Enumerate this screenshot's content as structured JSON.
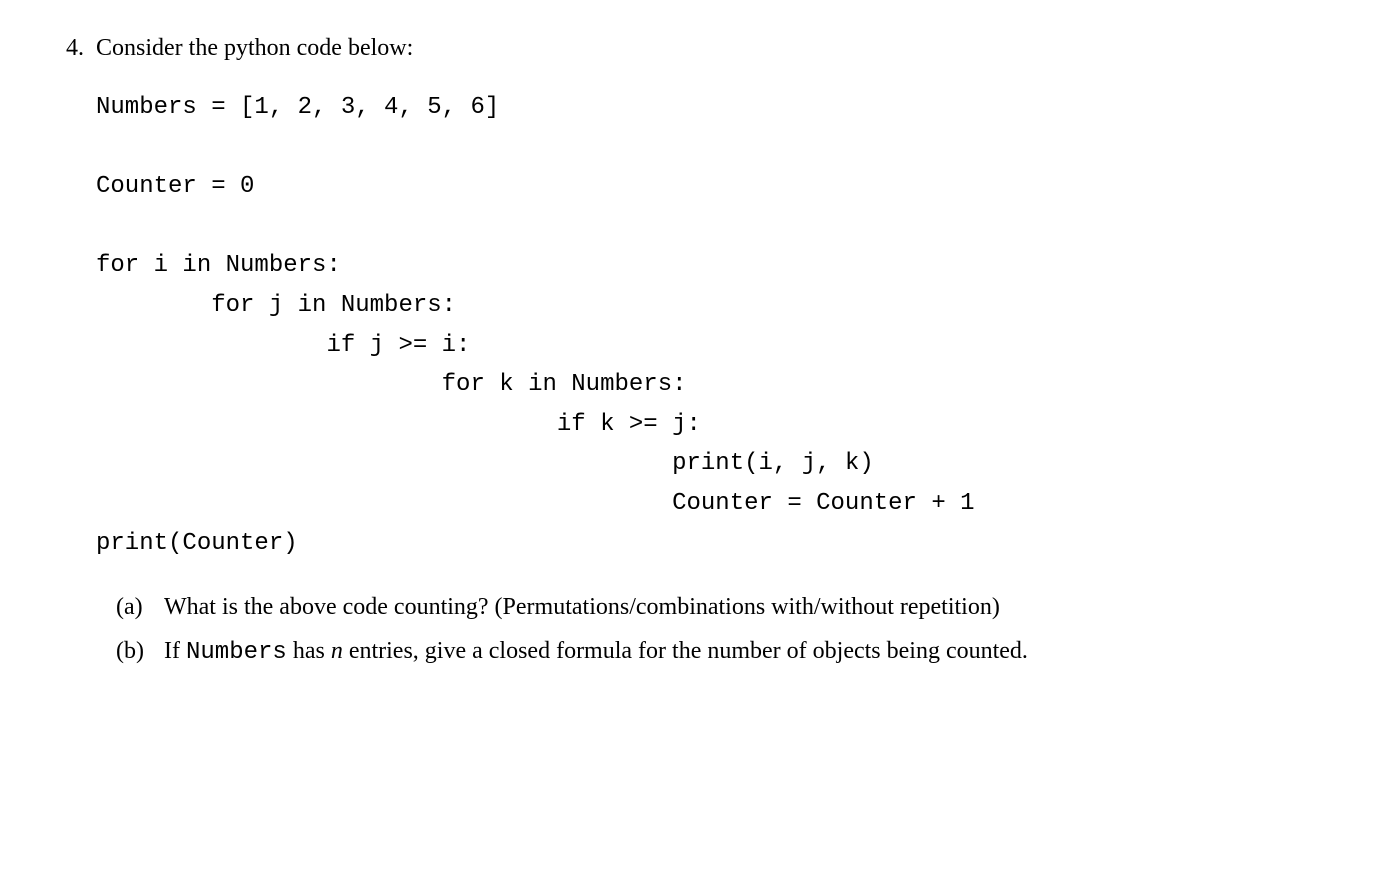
{
  "problem": {
    "number": "4.",
    "intro": "Consider the python code below:",
    "code": "Numbers = [1, 2, 3, 4, 5, 6]\n\nCounter = 0\n\nfor i in Numbers:\n        for j in Numbers:\n                if j >= i:\n                        for k in Numbers:\n                                if k >= j:\n                                        print(i, j, k)\n                                        Counter = Counter + 1\nprint(Counter)",
    "subproblems": [
      {
        "label": "(a)",
        "text_before": "What is the above code counting?  (Permutations/combinations with/without repetition)"
      },
      {
        "label": "(b)",
        "text_before": "If ",
        "tt_word": "Numbers",
        "text_mid": " has ",
        "italic_var": "n",
        "text_after": " entries, give a closed formula for the number of objects being counted."
      }
    ]
  }
}
